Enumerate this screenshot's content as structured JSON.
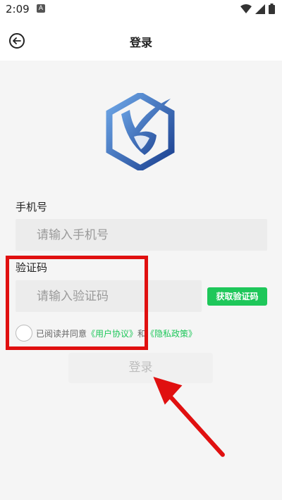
{
  "statusbar": {
    "time": "2:09",
    "app_indicator": "A",
    "icons": [
      "wifi-icon",
      "signal-icon",
      "battery-icon"
    ]
  },
  "appbar": {
    "back_icon": "arrow-left-circle-icon",
    "title": "登录"
  },
  "logo": {
    "icon": "shield-hexagon-logo"
  },
  "form": {
    "phone_label": "手机号",
    "phone_placeholder": "请输入手机号",
    "code_label": "验证码",
    "code_placeholder": "请输入验证码",
    "get_code_button": "获取验证码",
    "agree_prefix": "已阅读并同意",
    "user_agreement": "《用户协议》",
    "and": "和",
    "privacy_policy": "《隐私政策》",
    "login_button": "登录"
  },
  "colors": {
    "accent_green": "#1ec75a",
    "annotation_red": "#e01010",
    "background": "#f5f5f5"
  }
}
